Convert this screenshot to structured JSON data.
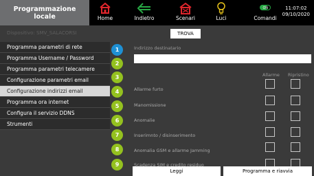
{
  "header": {
    "brand_line1": "Programmazione",
    "brand_line2": "locale",
    "nav": {
      "home": "Home",
      "indietro": "Indietro",
      "scenari": "Scenari",
      "luci": "Luci",
      "comandi": "Comandi"
    },
    "time": "11:07:02",
    "date": "09/10/2020"
  },
  "device_label": "Dispositivo: SMV_SALACORSI",
  "trova_label": "TROVA",
  "menu": {
    "items": [
      "Programma parametri di rete",
      "Programma Username / Password",
      "Programma parametri telecamere",
      "Configurazione parametri email",
      "Configurazione indirizzi email",
      "Programma ora internet",
      "Configura il servizio DDNS",
      "Strumenti"
    ]
  },
  "steps": [
    "1",
    "2",
    "3",
    "4",
    "5",
    "6",
    "7",
    "8",
    "9"
  ],
  "form": {
    "address_label": "Indirizzo destinatario",
    "address_value": "",
    "col_allarme": "Allarme",
    "col_ripristino": "Ripristino",
    "rows": [
      "Allarme furto",
      "Manomissione",
      "Anomalie",
      "Inserimnto / disinserimento",
      "Anomalia GSM e allarme Jamming",
      "Scadenza SIM e credito residuo"
    ]
  },
  "buttons": {
    "leggi": "Leggi",
    "programma": "Programma e riavvia"
  },
  "colors": {
    "step_green": "#94c11f",
    "step_active_blue": "#1e90d4",
    "home_icon_red": "#e0262c",
    "nav_green": "#27a844",
    "menu_selected": "#d7d7d7"
  }
}
